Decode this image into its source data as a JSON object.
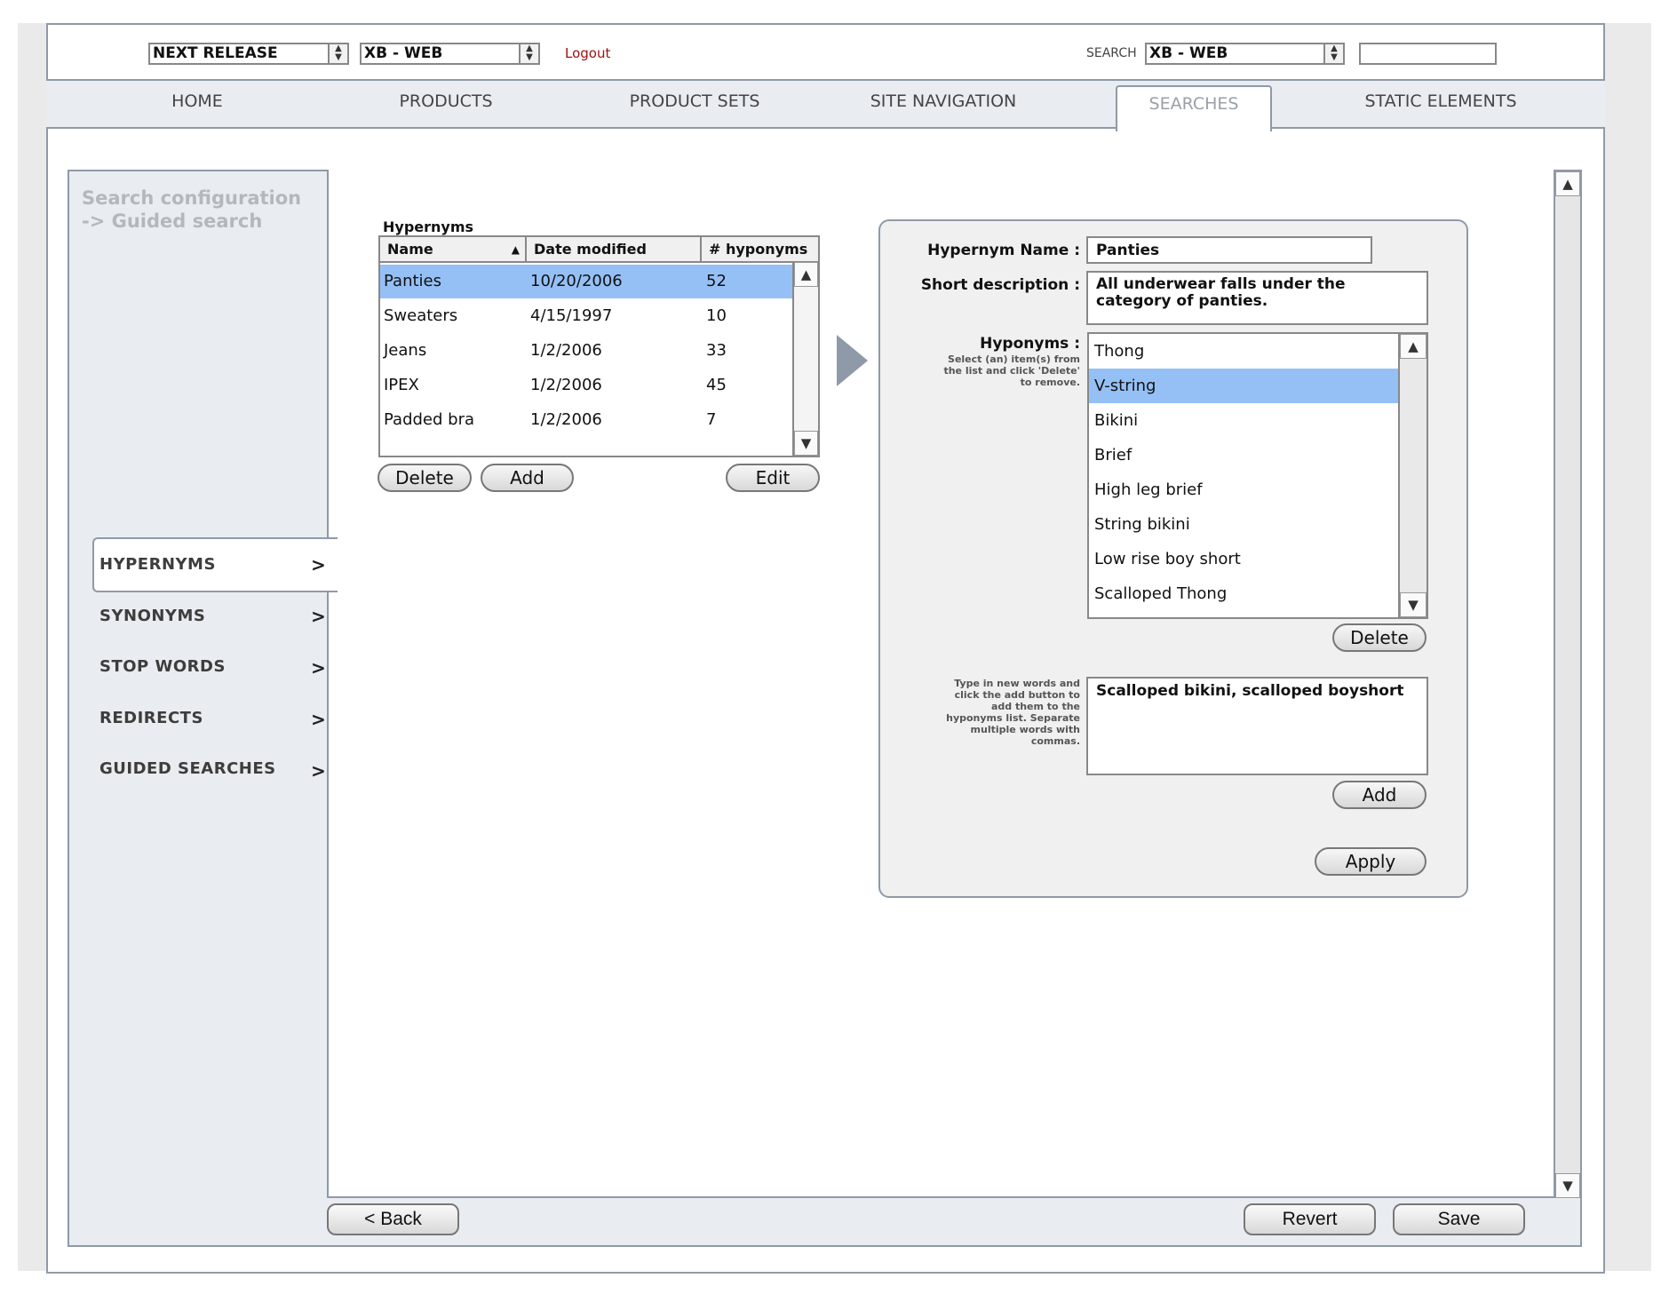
{
  "top_bar": {
    "release_select": "NEXT RELEASE",
    "site_select": "XB - WEB",
    "logout": "Logout",
    "search_label": "SEARCH",
    "search_scope_select": "XB - WEB",
    "search_value": ""
  },
  "nav": {
    "home": "HOME",
    "products": "PRODUCTS",
    "product_sets": "PRODUCT SETS",
    "site_navigation": "SITE NAVIGATION",
    "searches": "SEARCHES",
    "static_elements": "STATIC ELEMENTS",
    "active": "SEARCHES"
  },
  "breadcrumb": {
    "line1": "Search configuration",
    "line2": "-> Guided search"
  },
  "sidebar": {
    "arrow": ">",
    "items": [
      {
        "label": "HYPERNYMS",
        "active": true
      },
      {
        "label": "SYNONYMS",
        "active": false
      },
      {
        "label": "STOP WORDS",
        "active": false
      },
      {
        "label": "REDIRECTS",
        "active": false
      },
      {
        "label": "GUIDED SEARCHES",
        "active": false
      }
    ]
  },
  "hypernyms": {
    "title": "Hypernyms",
    "columns": [
      "Name",
      "Date modified",
      "# hyponyms"
    ],
    "sort_indicator": "▲",
    "rows": [
      {
        "name": "Panties",
        "date": "10/20/2006",
        "count": "52",
        "selected": true
      },
      {
        "name": "Sweaters",
        "date": "4/15/1997",
        "count": "10",
        "selected": false
      },
      {
        "name": "Jeans",
        "date": "1/2/2006",
        "count": "33",
        "selected": false
      },
      {
        "name": "IPEX",
        "date": "1/2/2006",
        "count": "45",
        "selected": false
      },
      {
        "name": "Padded bra",
        "date": "1/2/2006",
        "count": "7",
        "selected": false
      }
    ],
    "buttons": {
      "delete": "Delete",
      "add": "Add",
      "edit": "Edit"
    }
  },
  "detail": {
    "name_label": "Hypernym Name :",
    "name_value": "Panties",
    "desc_label": "Short description :",
    "desc_value": "All underwear falls under the category of panties.",
    "hyponyms_label": "Hyponyms :",
    "hyponyms_hint": "Select (an) item(s) from the list and click 'Delete' to remove.",
    "hyponyms": [
      "Thong",
      "V-string",
      "Bikini",
      "Brief",
      "High leg brief",
      "String bikini",
      "Low rise boy short",
      "Scalloped Thong"
    ],
    "selected_hyponym": "V-string",
    "delete_button": "Delete",
    "new_words_hint": "Type in new words and click the add button to add them to the hyponyms list. Separate multiple words with commas.",
    "new_words_value": "Scalloped bikini, scalloped boyshort",
    "add_button": "Add",
    "apply_button": "Apply"
  },
  "footer": {
    "back": "< Back",
    "revert": "Revert",
    "save": "Save"
  },
  "icons": {
    "scroll_up": "▲",
    "scroll_down": "▼",
    "select_up": "▲",
    "select_down": "▼"
  },
  "colors": {
    "selection": "#95c0f6",
    "frame": "#8f9aa8",
    "panel_bg": "#e9edf1",
    "logout": "#a01010",
    "breadcrumb": "#b4b8bd"
  }
}
